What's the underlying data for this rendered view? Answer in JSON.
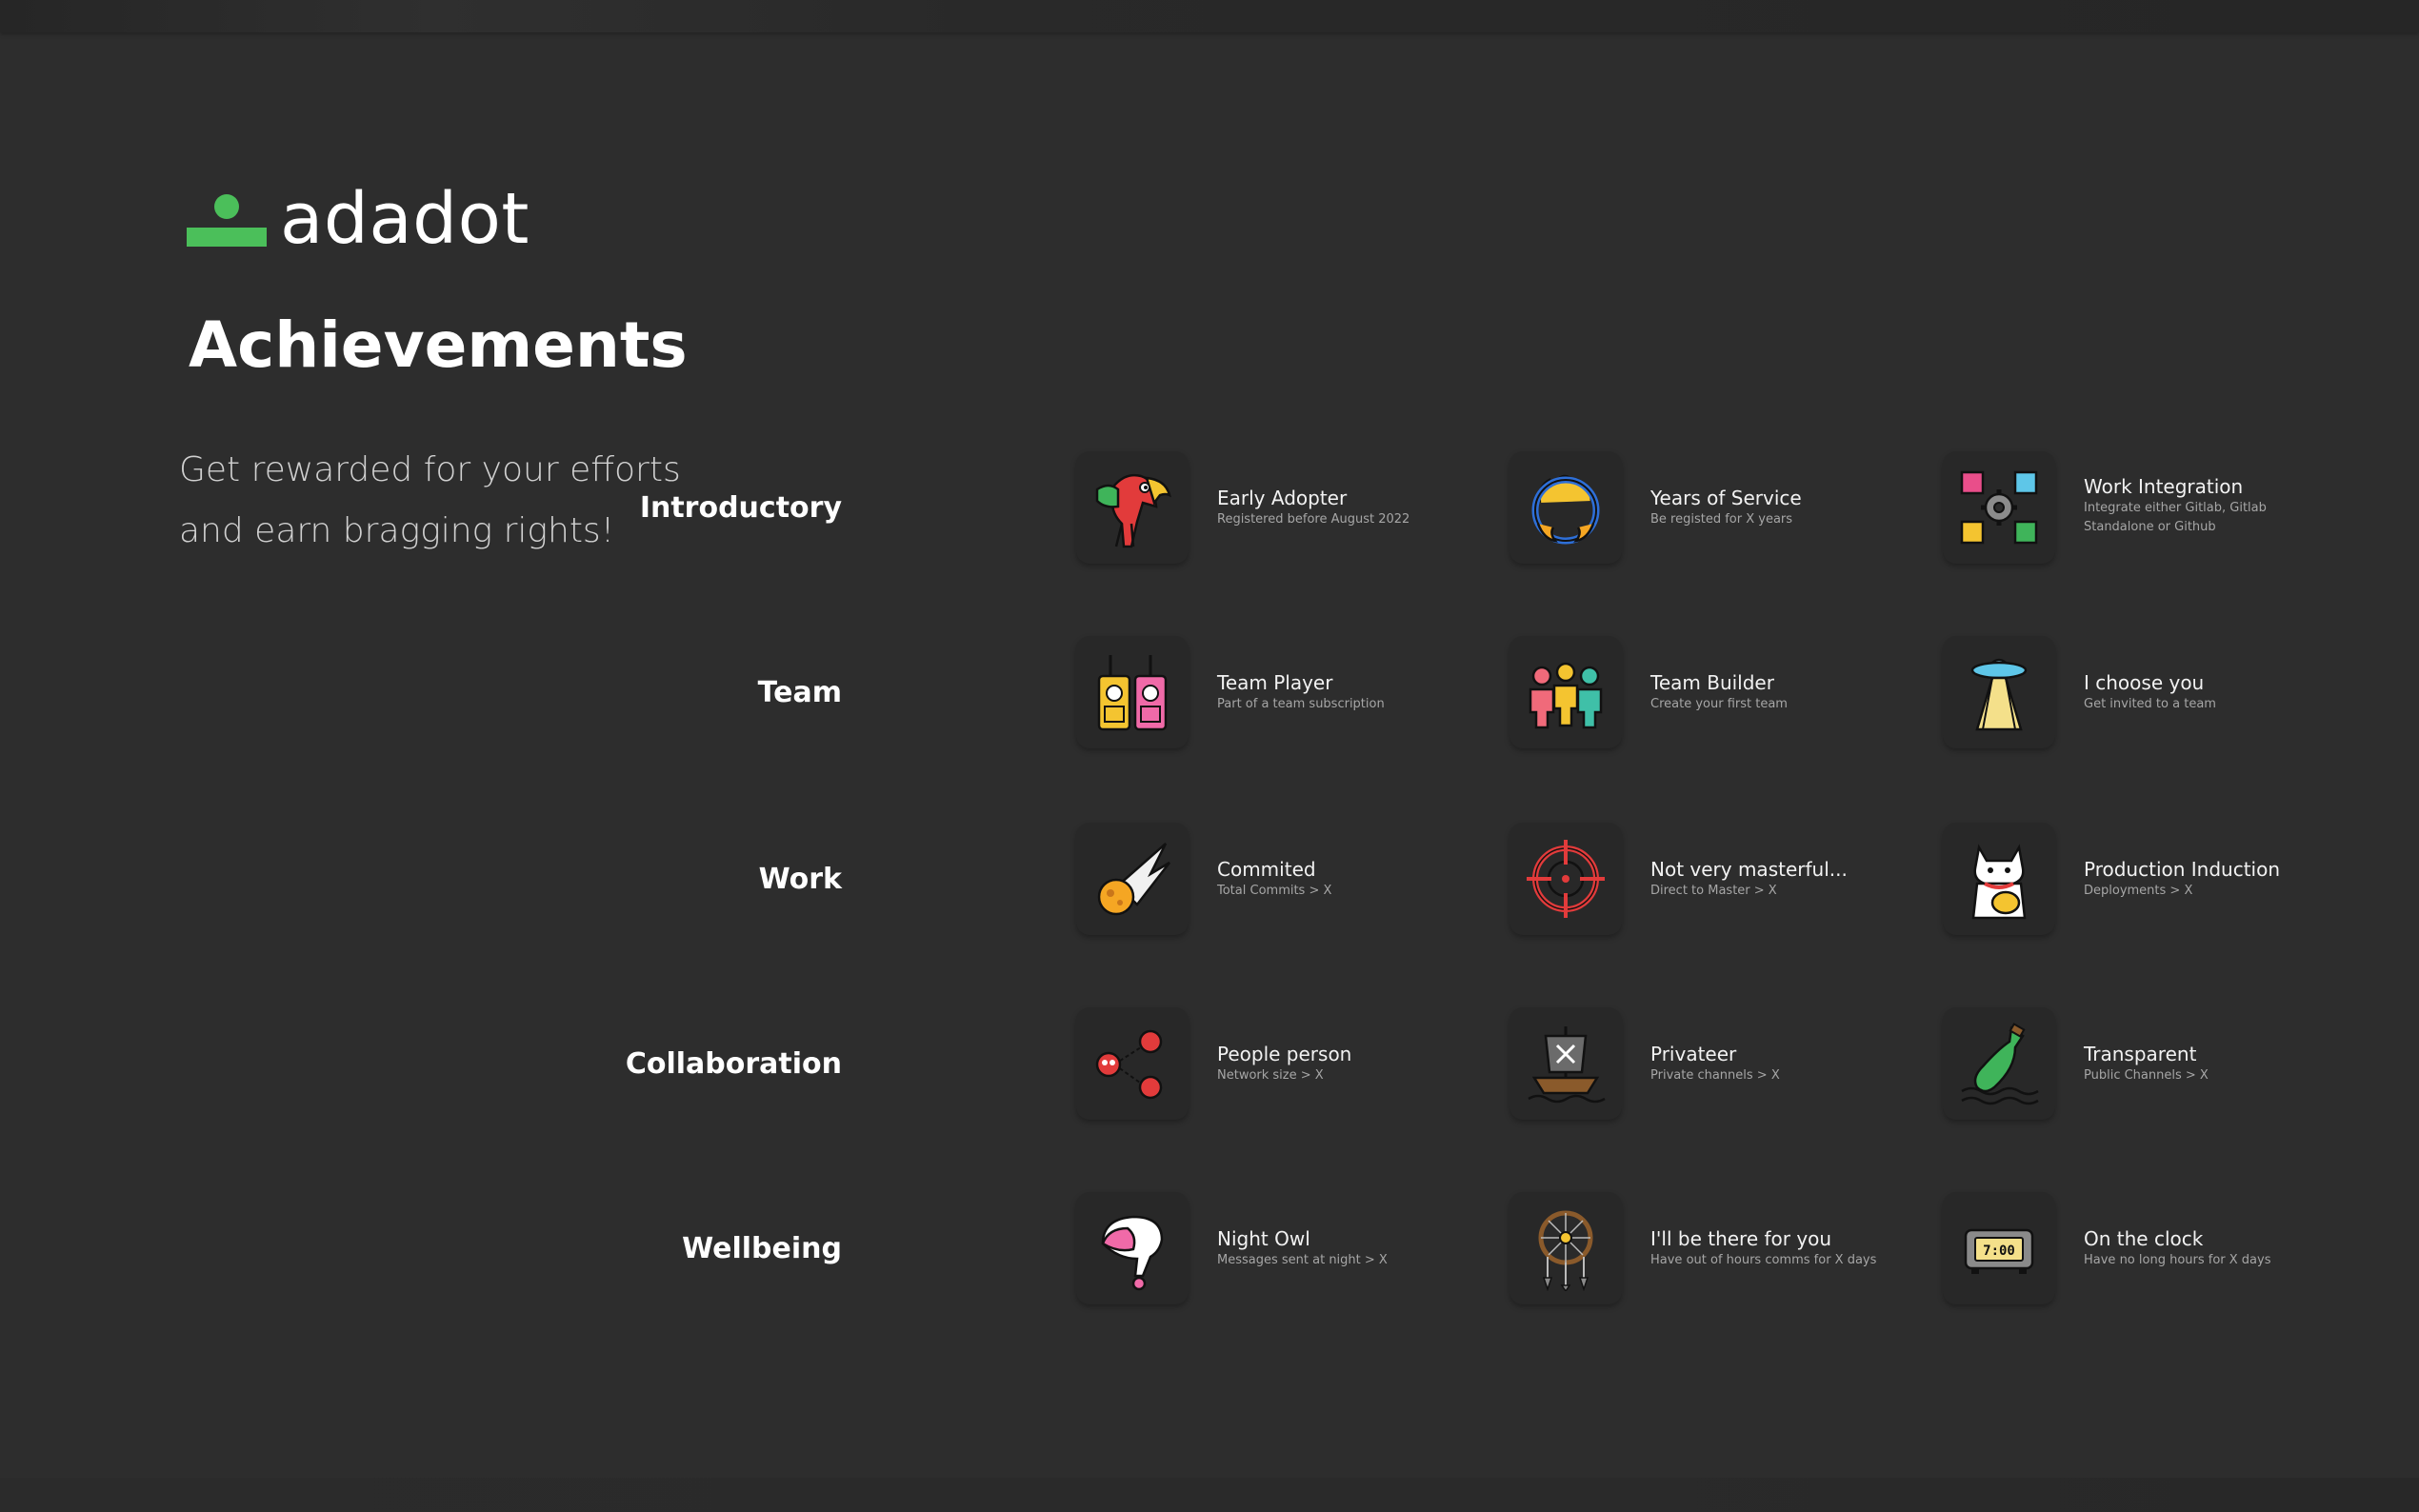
{
  "brand": {
    "name": "adadot",
    "accent": "#4bbf5a"
  },
  "page": {
    "title": "Achievements",
    "subtitle": "Get rewarded for your efforts and earn bragging rights!"
  },
  "categories": [
    {
      "label": "Introductory",
      "items": [
        {
          "name": "Early Adopter",
          "desc": "Registered before August 2022",
          "icon": "parrot-icon"
        },
        {
          "name": "Years of Service",
          "desc": "Be registed for X years",
          "icon": "fire-ring-icon"
        },
        {
          "name": "Work Integration",
          "desc": "Integrate either Gitlab, Gitlab Standalone or Github",
          "icon": "puzzle-gear-icon"
        }
      ]
    },
    {
      "label": "Team",
      "items": [
        {
          "name": "Team Player",
          "desc": "Part of a team subscription",
          "icon": "walkie-talkie-icon"
        },
        {
          "name": "Team Builder",
          "desc": "Create your first team",
          "icon": "people-icon"
        },
        {
          "name": "I choose you",
          "desc": "Get invited to a team",
          "icon": "ufo-icon"
        }
      ]
    },
    {
      "label": "Work",
      "items": [
        {
          "name": "Commited",
          "desc": "Total Commits > X",
          "icon": "meteor-icon"
        },
        {
          "name": "Not very masterful...",
          "desc": "Direct to Master > X",
          "icon": "crosshair-icon"
        },
        {
          "name": "Production Induction",
          "desc": "Deployments > X",
          "icon": "lucky-cat-icon"
        }
      ]
    },
    {
      "label": "Collaboration",
      "items": [
        {
          "name": "People person",
          "desc": "Network size > X",
          "icon": "network-icon"
        },
        {
          "name": "Privateer",
          "desc": "Private channels > X",
          "icon": "pirate-ship-icon"
        },
        {
          "name": "Transparent",
          "desc": "Public Channels > X",
          "icon": "bottle-icon"
        }
      ]
    },
    {
      "label": "Wellbeing",
      "items": [
        {
          "name": "Night Owl",
          "desc": "Messages sent at night > X",
          "icon": "nightcap-icon"
        },
        {
          "name": "I'll be there for you",
          "desc": "Have out of hours comms for X days",
          "icon": "dreamcatcher-icon"
        },
        {
          "name": "On the clock",
          "desc": "Have no long hours for X days",
          "icon": "alarm-clock-icon"
        }
      ]
    }
  ],
  "clock_face": "7:00"
}
